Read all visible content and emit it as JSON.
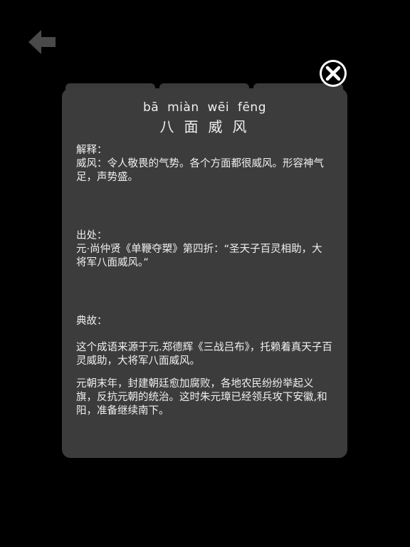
{
  "nav": {
    "back_icon": "back-arrow-icon",
    "close_icon": "close-circle-icon"
  },
  "idiom": {
    "pinyin": "bā  miàn  wēi  fēng",
    "headword": "八面威风"
  },
  "explanation": {
    "label": "解释：",
    "text": "威风：令人敬畏的气势。各个方面都很威风。形容神气足，声势盛。"
  },
  "source": {
    "label": "出处：",
    "text": "元·尚仲贤《单鞭夺槊》第四折：“圣天子百灵相助，大将军八面威风。”"
  },
  "story": {
    "label": "典故：",
    "paragraph1": "这个成语来源于元.郑德辉《三战吕布》，托赖着真天子百灵威助，大将军八面威风。",
    "paragraph2": "元朝末年，封建朝廷愈加腐败，各地农民纷纷举起义旗，反抗元朝的统治。这时朱元璋已经领兵攻下安徽,和阳，准备继续南下。"
  },
  "colors": {
    "background": "#000000",
    "card": "#3c3c3c",
    "text": "#f0f0f0",
    "icon": "#4a4a4a"
  }
}
